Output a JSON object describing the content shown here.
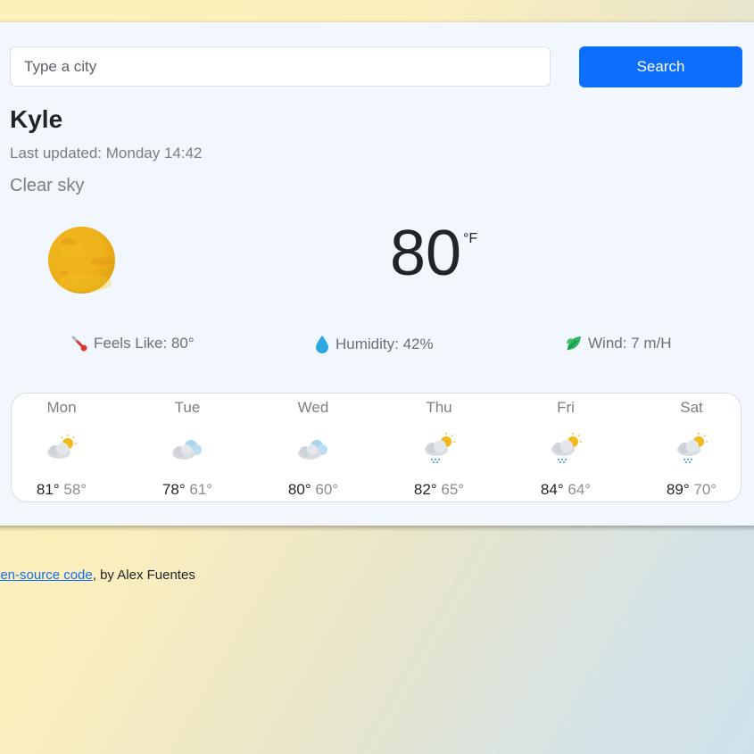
{
  "search": {
    "placeholder": "Type a city",
    "button_label": "Search"
  },
  "weather": {
    "city": "Kyle",
    "last_updated": "Last updated: Monday 14:42",
    "description": "Clear sky",
    "icon": "clear-sky-sun-icon",
    "temperature": "80",
    "unit": "°F",
    "feels_like": "Feels Like: 80°",
    "humidity": "Humidity: 42%",
    "wind": "Wind: 7 m/H"
  },
  "forecast": [
    {
      "day": "Mon",
      "high": "81°",
      "low": "58°",
      "icon": "partly-cloudy-icon"
    },
    {
      "day": "Tue",
      "high": "78°",
      "low": "61°",
      "icon": "cloudy-icon"
    },
    {
      "day": "Wed",
      "high": "80°",
      "low": "60°",
      "icon": "cloudy-icon"
    },
    {
      "day": "Thu",
      "high": "82°",
      "low": "65°",
      "icon": "rain-sun-icon"
    },
    {
      "day": "Fri",
      "high": "84°",
      "low": "64°",
      "icon": "rain-sun-icon"
    },
    {
      "day": "Sat",
      "high": "89°",
      "low": "70°",
      "icon": "rain-sun-icon"
    }
  ],
  "footer": {
    "link_text": "pen-source code",
    "suffix": ", by Alex Fuentes"
  },
  "colors": {
    "accent": "#0d6efd",
    "sun": "#f2b81c"
  }
}
